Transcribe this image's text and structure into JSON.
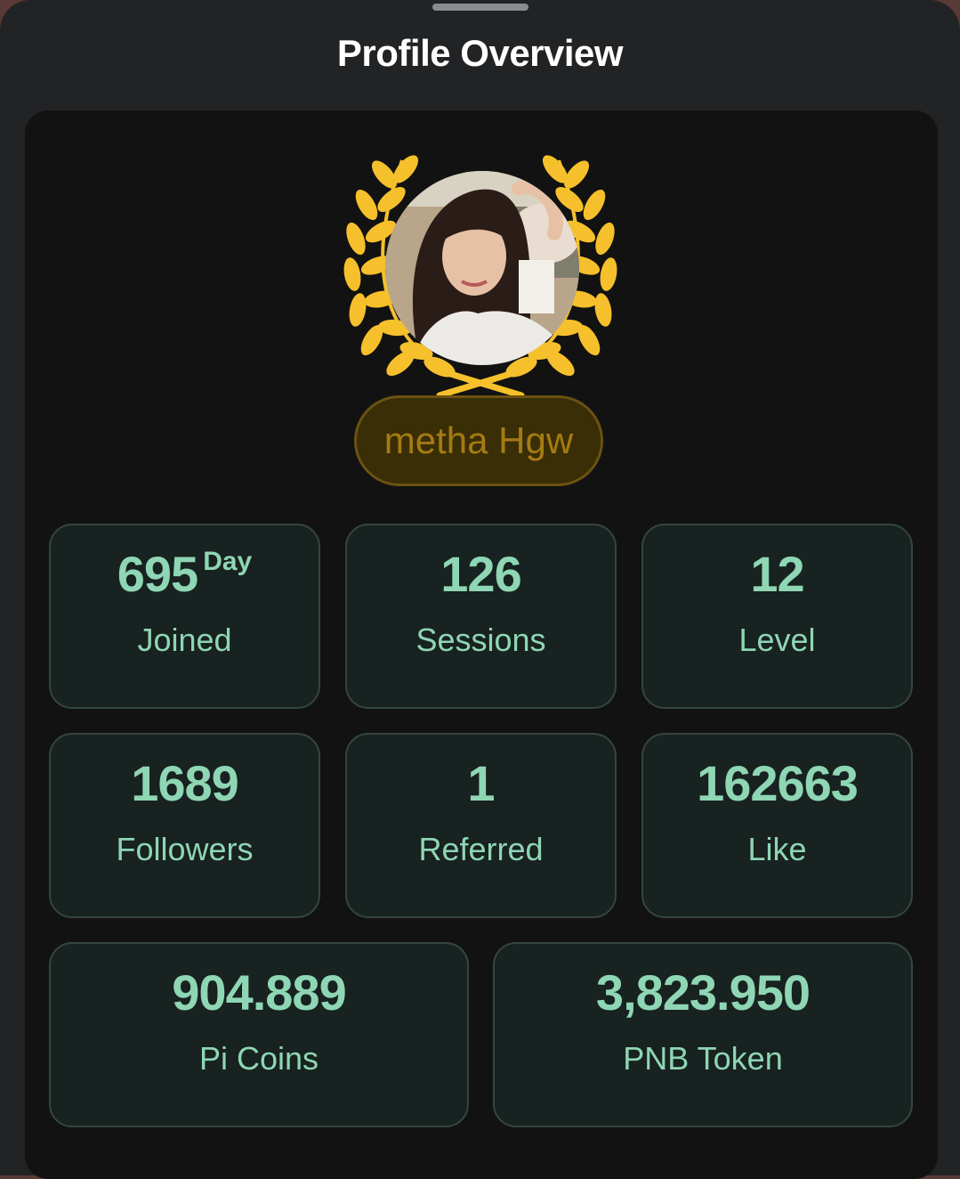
{
  "header": {
    "title": "Profile Overview"
  },
  "profile": {
    "name": "metha Hgw",
    "avatar_icon": "user-photo",
    "badge_icon": "laurel-wreath-icon",
    "accent": "#f5c02b"
  },
  "stats": [
    {
      "value": "695",
      "unit": "Day",
      "label": "Joined"
    },
    {
      "value": "126",
      "label": "Sessions"
    },
    {
      "value": "12",
      "label": "Level"
    },
    {
      "value": "1689",
      "label": "Followers"
    },
    {
      "value": "1",
      "label": "Referred"
    },
    {
      "value": "162663",
      "label": "Like"
    },
    {
      "value": "904.889",
      "label": "Pi Coins"
    },
    {
      "value": "3,823.950",
      "label": "PNB Token"
    }
  ],
  "colors": {
    "stat_text": "#8ed6b4",
    "card_bg": "#182220",
    "name_text": "#a57b12"
  }
}
